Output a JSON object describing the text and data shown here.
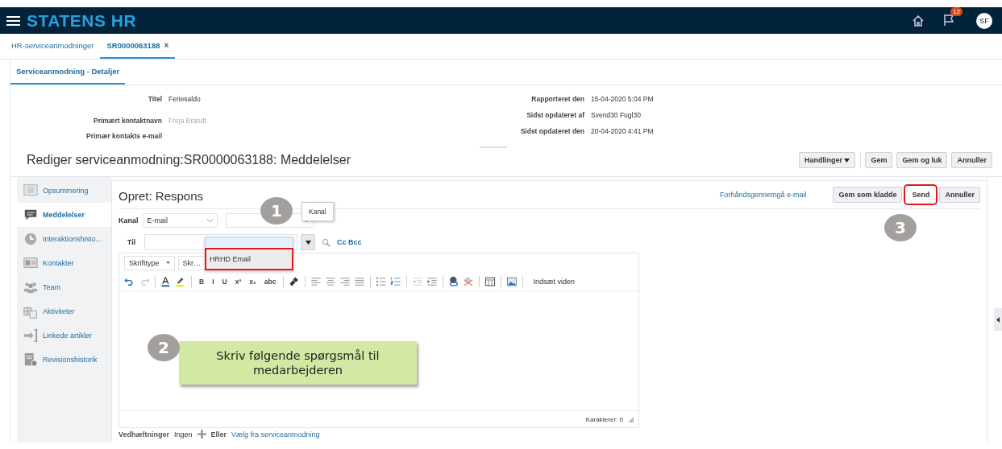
{
  "header": {
    "app_title": "STATENS HR",
    "notification_count": "12",
    "avatar_initials": "SF"
  },
  "tabs": [
    {
      "label": "HR-serviceanmodninger",
      "selected": false
    },
    {
      "label": "SR0000063188",
      "selected": true,
      "close": "×"
    }
  ],
  "subtabs": [
    {
      "label": "Serviceanmodning - Detaljer",
      "selected": true
    }
  ],
  "details": {
    "left": [
      {
        "label": "Titel",
        "value": "Feriesaldo",
        "muted": false
      },
      {
        "label": "Primært kontaktnavn",
        "value": "Freja Brandt",
        "muted": true
      },
      {
        "label": "Primær kontakts e-mail"
      }
    ],
    "right": [
      {
        "label": "Rapporteret den",
        "value": "15-04-2020 5:04 PM",
        "muted": false
      },
      {
        "label": "Sidst opdateret af",
        "value": "Svend30 Fugl30",
        "muted": false
      },
      {
        "label": "Sidst opdateret den",
        "value": "20-04-2020 4:41 PM",
        "muted": false
      }
    ]
  },
  "page_title": "Rediger serviceanmodning:SR0000063188: Meddelelser",
  "page_actions": [
    {
      "label": "Handlinger",
      "kind": "menu"
    },
    {
      "label": "Gem",
      "kind": "button"
    },
    {
      "label": "Gem og luk",
      "kind": "button"
    },
    {
      "label": "Annuller",
      "kind": "button"
    }
  ],
  "sidebar": [
    {
      "label": "Opsummering",
      "selected": false
    },
    {
      "label": "Meddelelser",
      "selected": true
    },
    {
      "label": "Interaktionshisto...",
      "selected": false
    },
    {
      "label": "Kontakter",
      "selected": false
    },
    {
      "label": "Team",
      "selected": false
    },
    {
      "label": "Aktiviteter",
      "selected": false
    },
    {
      "label": "Linkede artikler",
      "selected": false
    },
    {
      "label": "Revisionshistorik",
      "selected": false
    }
  ],
  "compose": {
    "title": "Opret: Respons",
    "preview_link": "Forhåndsgennemgå e-mail",
    "actions": [
      {
        "label": "Gem som kladde",
        "highlighted": false
      },
      {
        "label": "Send",
        "highlighted": true
      },
      {
        "label": "Annuller",
        "highlighted": false
      }
    ],
    "channel_label": "Kanal",
    "channel_value": "E-mail",
    "channel_dropdown": {
      "expanded": true,
      "options": [
        {
          "label": "HRHD Email",
          "highlighted": true
        }
      ]
    },
    "to_label": "Til",
    "cc_bcc": "Cc Bcc",
    "editor": {
      "font_family": "Skrifttype",
      "font_size": "Skr…",
      "format_glyphs": [
        "B",
        "I",
        "U",
        "x²",
        "x₂",
        "abc"
      ],
      "insert_knowledge": "Indsæt viden",
      "char_count": "Karakterer: 0"
    },
    "attachments": {
      "label": "Vedhæftninger",
      "value": "Ingen",
      "or": "Eller",
      "link": "Vælg fra serviceanmodning"
    }
  },
  "tooltip": "Kanal",
  "callouts": [
    {
      "number": "1"
    },
    {
      "number": "2",
      "text": "Skriv følgende spørgsmål til medarbejderen"
    },
    {
      "number": "3"
    }
  ]
}
